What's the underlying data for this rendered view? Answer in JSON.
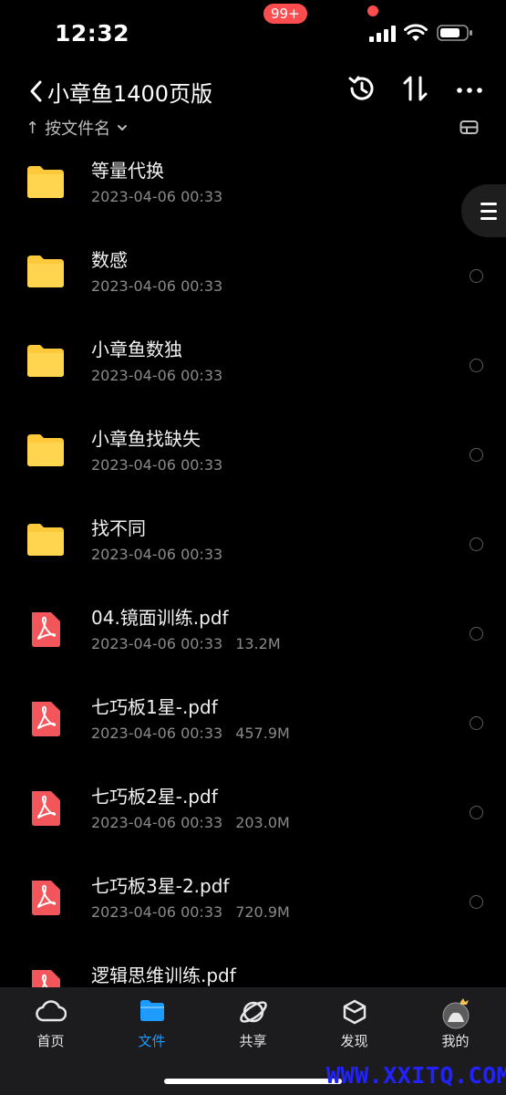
{
  "status_bar": {
    "time": "12:32"
  },
  "header": {
    "title": "小章鱼1400页版"
  },
  "sort": {
    "label": "按文件名"
  },
  "files": [
    {
      "name": "等量代换",
      "date": "2023-04-06 00:33",
      "size": "",
      "type": "folder"
    },
    {
      "name": "数感",
      "date": "2023-04-06 00:33",
      "size": "",
      "type": "folder"
    },
    {
      "name": "小章鱼数独",
      "date": "2023-04-06 00:33",
      "size": "",
      "type": "folder"
    },
    {
      "name": "小章鱼找缺失",
      "date": "2023-04-06 00:33",
      "size": "",
      "type": "folder"
    },
    {
      "name": "找不同",
      "date": "2023-04-06 00:33",
      "size": "",
      "type": "folder"
    },
    {
      "name": "04.镜面训练.pdf",
      "date": "2023-04-06 00:33",
      "size": "13.2M",
      "type": "pdf"
    },
    {
      "name": "七巧板1星-.pdf",
      "date": "2023-04-06 00:33",
      "size": "457.9M",
      "type": "pdf"
    },
    {
      "name": "七巧板2星-.pdf",
      "date": "2023-04-06 00:33",
      "size": "203.0M",
      "type": "pdf"
    },
    {
      "name": "七巧板3星-2.pdf",
      "date": "2023-04-06 00:33",
      "size": "720.9M",
      "type": "pdf"
    },
    {
      "name": "逻辑思维训练.pdf",
      "date": "",
      "size": "",
      "type": "pdf"
    }
  ],
  "tabs": [
    {
      "label": "首页",
      "icon": "cloud-icon"
    },
    {
      "label": "文件",
      "icon": "folder-icon"
    },
    {
      "label": "共享",
      "icon": "share-orbit-icon"
    },
    {
      "label": "发现",
      "icon": "cube-icon"
    },
    {
      "label": "我的",
      "icon": "avatar"
    }
  ],
  "share_badge": "99+",
  "watermark": "WWW.XXITQ.COM",
  "colors": {
    "accent": "#1e9bff",
    "folder": "#ffc93c",
    "pdf": "#f2555a",
    "badge": "#ff4d4f"
  }
}
